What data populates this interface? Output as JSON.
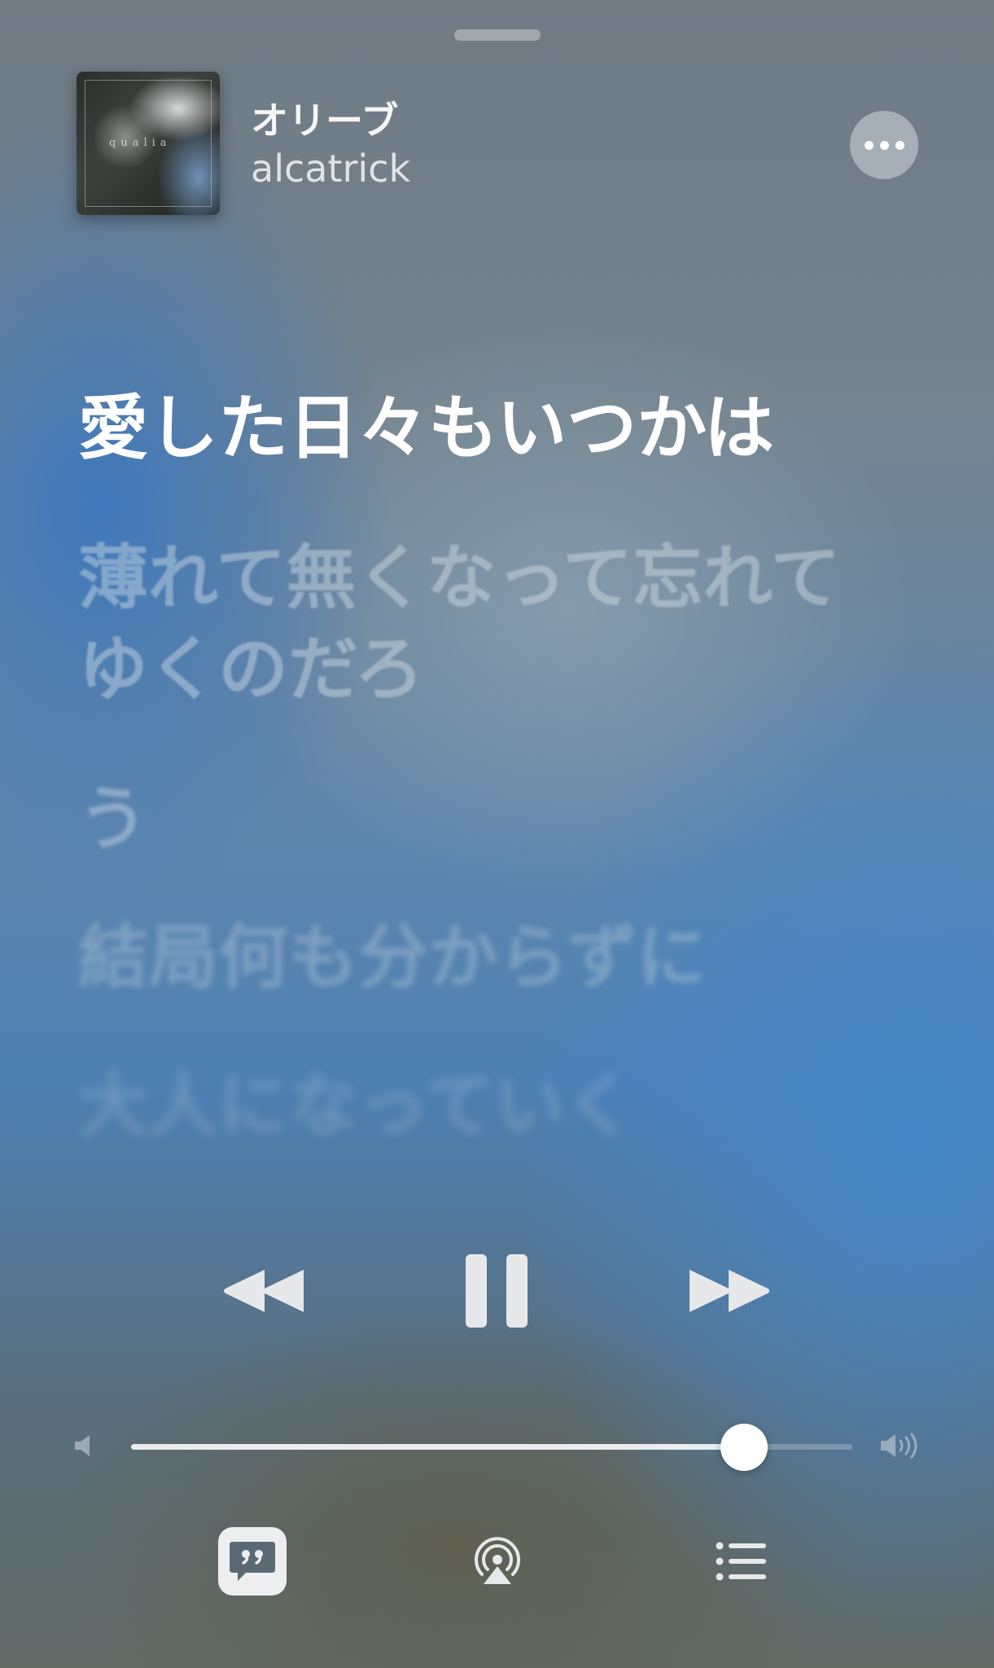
{
  "now_playing": {
    "title": "オリーブ",
    "artist": "alcatrick",
    "artwork_text": "qualia"
  },
  "lyrics": {
    "current": "愛した日々もいつかは",
    "upcoming": [
      "薄れて無くなって忘れて",
      "ゆくのだろ",
      "う",
      "結局何も分からずに",
      "大人になっていく"
    ]
  },
  "controls": {
    "previous_icon": "rewind-icon",
    "play_pause_icon": "pause-icon",
    "next_icon": "fast-forward-icon",
    "more_icon": "ellipsis-icon"
  },
  "volume": {
    "level": 0.85,
    "low_icon": "speaker-low-icon",
    "high_icon": "speaker-high-icon"
  },
  "bottom_bar": {
    "lyrics_icon": "lyrics-quote-icon",
    "airplay_icon": "airplay-audio-icon",
    "queue_icon": "queue-list-icon"
  },
  "colors": {
    "accent": "#ffffff",
    "control_fill": "#e6e8ea"
  }
}
